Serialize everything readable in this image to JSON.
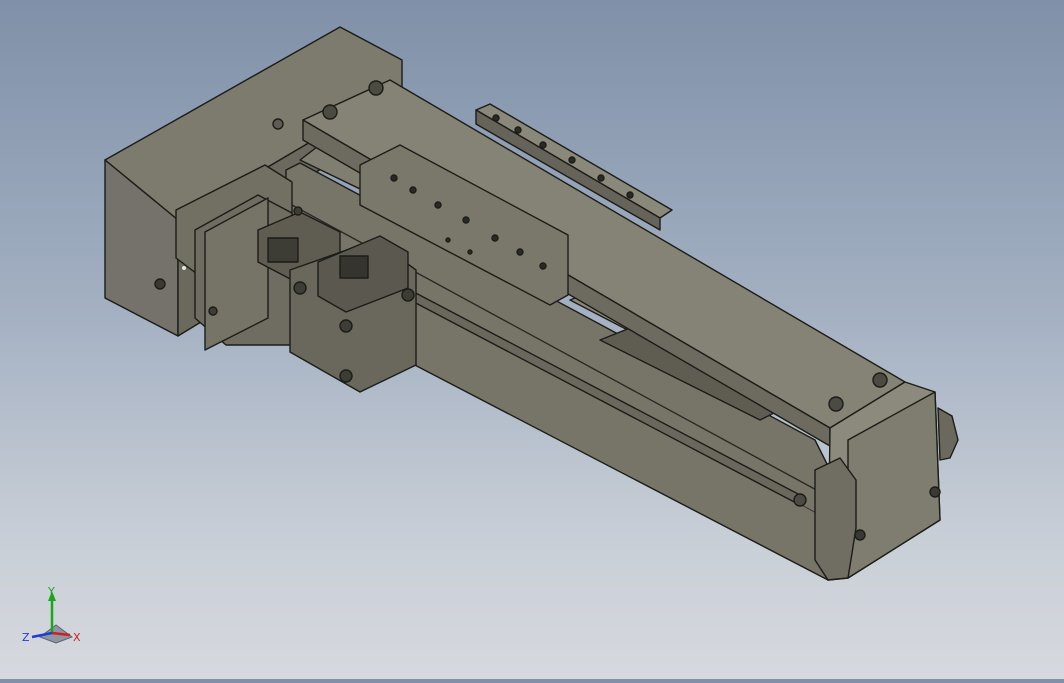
{
  "viewport": {
    "name": "3D model view",
    "background_top": "#7f90a8",
    "background_bottom": "#d6d9de",
    "model_color": "#7d7b6d",
    "edge_color": "#1c1c18"
  },
  "triad": {
    "x_label": "X",
    "y_label": "Y",
    "z_label": "Z",
    "x_color": "#d21e1e",
    "y_color": "#1ea51e",
    "z_color": "#1e3cd2"
  }
}
